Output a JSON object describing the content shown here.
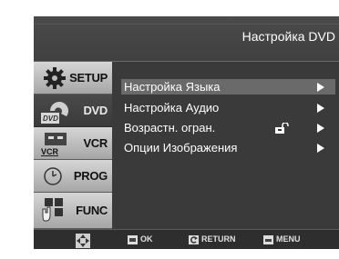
{
  "title": "Настройка DVD",
  "sidebar": {
    "items": [
      {
        "label": "SETUP",
        "icon": "gear-icon"
      },
      {
        "label": "DVD",
        "icon": "dvd-disc-icon",
        "icon_text": "DVD"
      },
      {
        "label": "VCR",
        "icon": "vcr-icon",
        "icon_text": "VCR"
      },
      {
        "label": "PROG",
        "icon": "clock-icon"
      },
      {
        "label": "FUNC",
        "icon": "func-grid-icon"
      }
    ],
    "selected": "DVD"
  },
  "menu": {
    "items": [
      {
        "label": "Настройка Языка",
        "selected": true
      },
      {
        "label": "Настройка Аудио",
        "selected": false
      },
      {
        "label": "Возрастн. огран.",
        "selected": false,
        "icon": "unlock-icon"
      },
      {
        "label": "Опции  Изображения",
        "selected": false
      }
    ]
  },
  "footer": {
    "ok_label": "OK",
    "return_label": "RETURN",
    "menu_label": "MENU"
  },
  "colors": {
    "screen_bg": "#3a3a3a",
    "sidebar_light": "#c0c0c0",
    "selected_row": "#6a6a6a",
    "text": "#ffffff"
  }
}
